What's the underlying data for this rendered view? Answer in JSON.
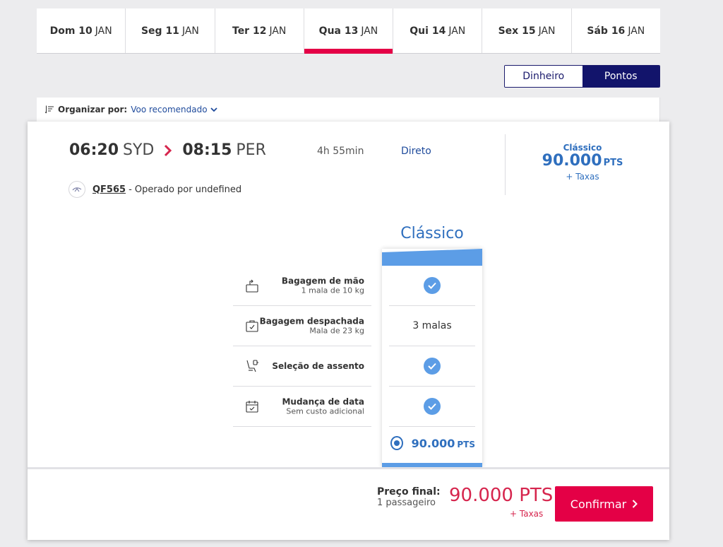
{
  "date_tabs": [
    {
      "day": "Dom 10",
      "month": "JAN",
      "active": false
    },
    {
      "day": "Seg 11",
      "month": "JAN",
      "active": false
    },
    {
      "day": "Ter 12",
      "month": "JAN",
      "active": false
    },
    {
      "day": "Qua 13",
      "month": "JAN",
      "active": true
    },
    {
      "day": "Qui 14",
      "month": "JAN",
      "active": false
    },
    {
      "day": "Sex 15",
      "month": "JAN",
      "active": false
    },
    {
      "day": "Sáb 16",
      "month": "JAN",
      "active": false
    }
  ],
  "currency_toggle": {
    "money_label": "Dinheiro",
    "points_label": "Pontos",
    "selected": "Pontos"
  },
  "sort": {
    "label": "Organizar por:",
    "value": "Voo recomendado"
  },
  "flight": {
    "depart_time": "06:20",
    "depart_airport": "SYD",
    "arrive_time": "08:15",
    "arrive_airport": "PER",
    "duration": "4h 55min",
    "stops": "Direto",
    "flight_number": "QF565",
    "operated_by": "- Operado por undefined",
    "summary_class": "Clássico",
    "summary_amount": "90.000",
    "summary_unit": "PTS",
    "summary_taxes": "+ Taxas"
  },
  "fare": {
    "class_name": "Clássico",
    "features": [
      {
        "name": "Bagagem de mão",
        "sub": "1 mala de 10 kg",
        "icon": "carry-on-bag-icon",
        "value": "check"
      },
      {
        "name": "Bagagem despachada",
        "sub": "Mala de 23 kg",
        "icon": "checked-bag-icon",
        "value": "3 malas"
      },
      {
        "name": "Seleção de assento",
        "sub": "",
        "icon": "seat-icon",
        "value": "check"
      },
      {
        "name": "Mudança de data",
        "sub": "Sem custo adicional",
        "icon": "calendar-change-icon",
        "value": "check"
      }
    ],
    "select_amount": "90.000",
    "select_unit": "PTS"
  },
  "footer": {
    "final_label": "Preço final:",
    "passengers": "1 passageiro",
    "final_price": "90.000 PTS",
    "taxes": "+ Taxas",
    "confirm_label": "Confirmar"
  },
  "colors": {
    "accent_red": "#e40046",
    "accent_blue": "#2f6fbe",
    "navy": "#12146b",
    "fare_blue": "#5c9de6"
  }
}
